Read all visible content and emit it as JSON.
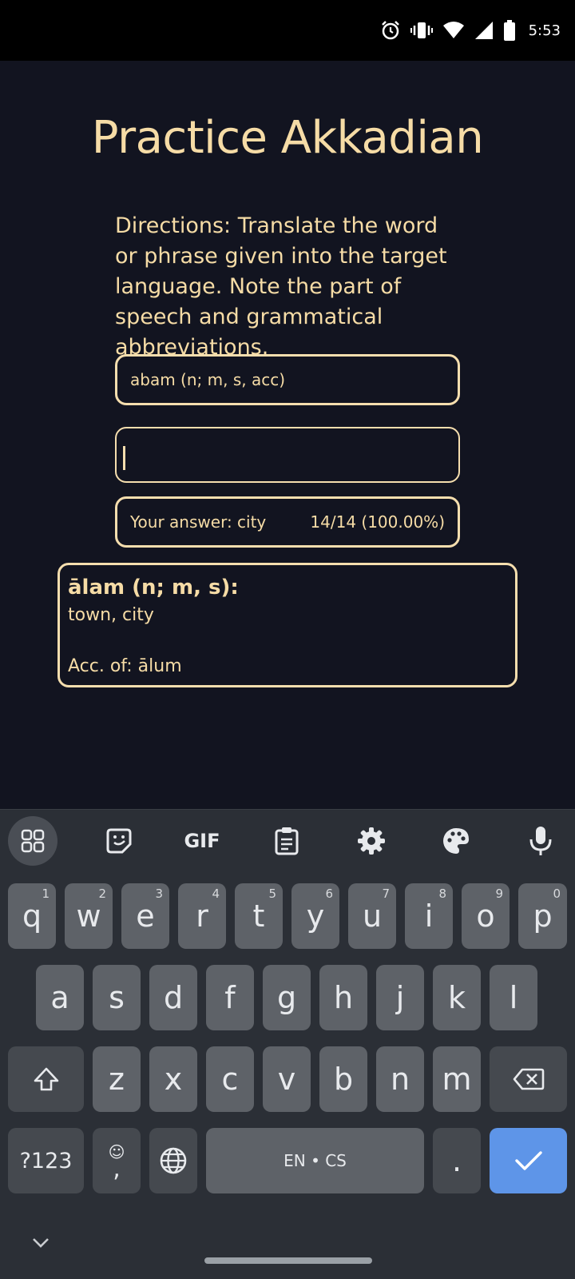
{
  "status_bar": {
    "time": "5:53",
    "icons": [
      "alarm-icon",
      "vibrate-icon",
      "wifi-icon",
      "signal-icon",
      "battery-icon"
    ]
  },
  "app": {
    "title": "Practice Akkadian",
    "directions": "Directions: Translate the word or phrase given into the target language. Note the part of speech and grammatical abbreviations.",
    "prompt": "abam (n; m, s, acc)",
    "answer_input": {
      "value": "",
      "placeholder": ""
    },
    "result": {
      "your_answer": "Your answer: city",
      "score": "14/14 (100.00%)"
    },
    "definition": {
      "headword": "ālam (n; m, s):",
      "meaning": "town, city",
      "note": "Acc. of: ālum"
    },
    "colors": {
      "background": "#121420",
      "accent": "#f5deae"
    }
  },
  "keyboard": {
    "toolbar": [
      "apps-icon",
      "sticker-icon",
      "GIF",
      "clipboard-icon",
      "settings-icon",
      "palette-icon",
      "microphone-icon"
    ],
    "gif_label": "GIF",
    "row1": [
      {
        "k": "q",
        "h": "1"
      },
      {
        "k": "w",
        "h": "2"
      },
      {
        "k": "e",
        "h": "3"
      },
      {
        "k": "r",
        "h": "4"
      },
      {
        "k": "t",
        "h": "5"
      },
      {
        "k": "y",
        "h": "6"
      },
      {
        "k": "u",
        "h": "7"
      },
      {
        "k": "i",
        "h": "8"
      },
      {
        "k": "o",
        "h": "9"
      },
      {
        "k": "p",
        "h": "0"
      }
    ],
    "row2": [
      "a",
      "s",
      "d",
      "f",
      "g",
      "h",
      "j",
      "k",
      "l"
    ],
    "row3": [
      "z",
      "x",
      "c",
      "v",
      "b",
      "n",
      "m"
    ],
    "symbols_label": "?123",
    "comma_label": ",",
    "emoji_glyph": "☺",
    "space_label": "EN • CS",
    "period_label": ".",
    "accent": "#5e95e8"
  }
}
